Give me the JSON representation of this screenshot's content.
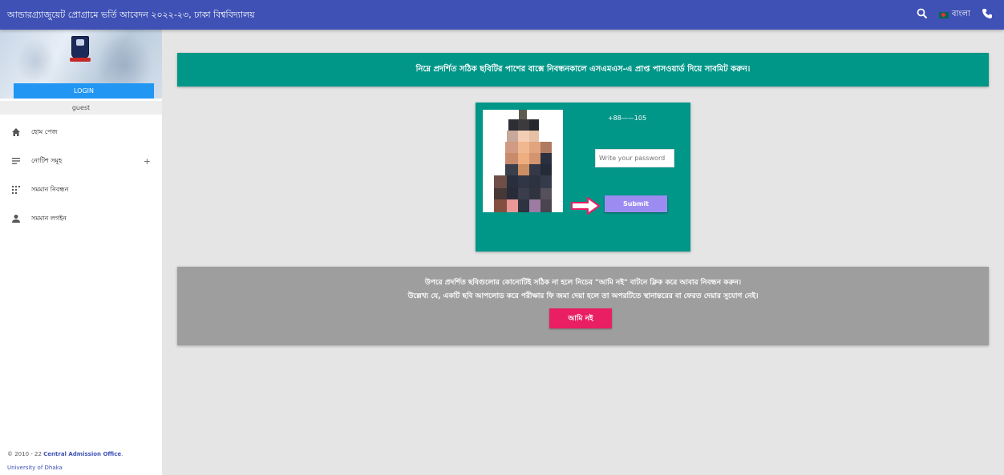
{
  "topbar": {
    "title": "আন্ডারগ্র্যাজুয়েট প্রোগ্রামে ভর্তি আবেদন ২০২২-২৩, ঢাকা বিশ্ববিদ্যালয়",
    "language_label": "বাংলা",
    "accent": "#3f51b5"
  },
  "sidebar": {
    "login_label": "LOGIN",
    "username": "guest",
    "items": [
      {
        "label": "হোম পেজ",
        "icon": "home-icon"
      },
      {
        "label": "নোটিশ সমূহ",
        "icon": "list-icon",
        "expand": "+"
      },
      {
        "label": "সমমান নিবন্ধন",
        "icon": "grid-icon"
      },
      {
        "label": "সমমান লগইন",
        "icon": "person-icon"
      }
    ],
    "footer": {
      "copyright": "© 2010 - 22 ",
      "office": "Central Admission Office",
      "period": ".",
      "university": "University of Dhaka"
    }
  },
  "main": {
    "banner_text": "নিম্নে প্রদর্শিত সঠিক ছবিটির পাশের বাক্সে নিবন্ধনকালে এসএমএস-এ প্রাপ্ত পাসওয়ার্ড দিয়ে সাবমিট করুন।",
    "card": {
      "phone": "+88——105",
      "password_placeholder": "Write your password",
      "submit_label": "Submit"
    },
    "notice": {
      "line1": "উপরে প্রদর্শিত ছবিগুলোর কোনোটিই সঠিক না হলে নিচের \"আমি নই\" বাটনে ক্লিক করে আবার নিবন্ধন করুন।",
      "line2": "উল্লেখ্য যে, একটি ছবি আপলোড করে পরীক্ষার ফি জমা দেয়া হলে তা অপরটিতে স্থানান্তরের বা ফেরত দেয়ার সুযোগ নেই।",
      "not_me_label": "আমি নই"
    }
  },
  "colors": {
    "teal": "#009688",
    "grey_box": "#9e9e9e",
    "pink_button": "#e91e63",
    "submit_button": "#9c8cf2",
    "login_button": "#2196f3"
  }
}
